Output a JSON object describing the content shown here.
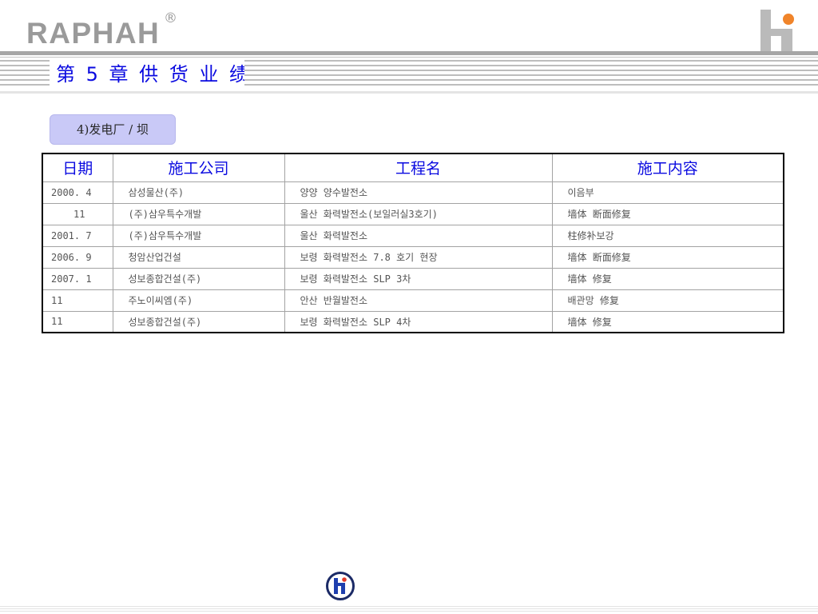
{
  "brand": {
    "name": "RAPHAH",
    "registered_mark": "®"
  },
  "header": {
    "title": "第 5 章 供 货 业 绩"
  },
  "section_tab": {
    "label": "4)发电厂 / 坝"
  },
  "table": {
    "columns": [
      "日期",
      "施工公司",
      "工程名",
      "施工内容"
    ],
    "rows": [
      [
        "2000. 4",
        "삼성물산(주)",
        "양양 양수발전소",
        "이음부"
      ],
      [
        "11",
        "(주)삼우특수개발",
        "울산 화력발전소(보일러실3호기)",
        "墙体 断面修复"
      ],
      [
        "2001. 7",
        "(주)삼우특수개발",
        "울산 화력발전소",
        "柱修补보강"
      ],
      [
        "2006. 9",
        "청암산업건설",
        "보령 화력발전소 7.8 호기 현장",
        "墙体 断面修复"
      ],
      [
        "2007. 1",
        "성보종합건설(주)",
        "보령 화력발전소 SLP 3차",
        "墙体 修复"
      ],
      [
        "11",
        "주노이씨엠(주)",
        "안산 반월발전소",
        "배관망 修复"
      ],
      [
        "11",
        "성보종합건설(주)",
        "보령 화력발전소 SLP 4차",
        "墙体 修复"
      ]
    ]
  },
  "icons": {
    "top_right_logo": "hi-logo-icon",
    "bottom_emblem": "hi-emblem-icon"
  },
  "colors": {
    "brand_gray": "#9a9a9a",
    "title_blue": "#0a0ae0",
    "tab_background": "#c9c9f7",
    "accent_orange": "#f0842a",
    "body_text": "#555555"
  }
}
